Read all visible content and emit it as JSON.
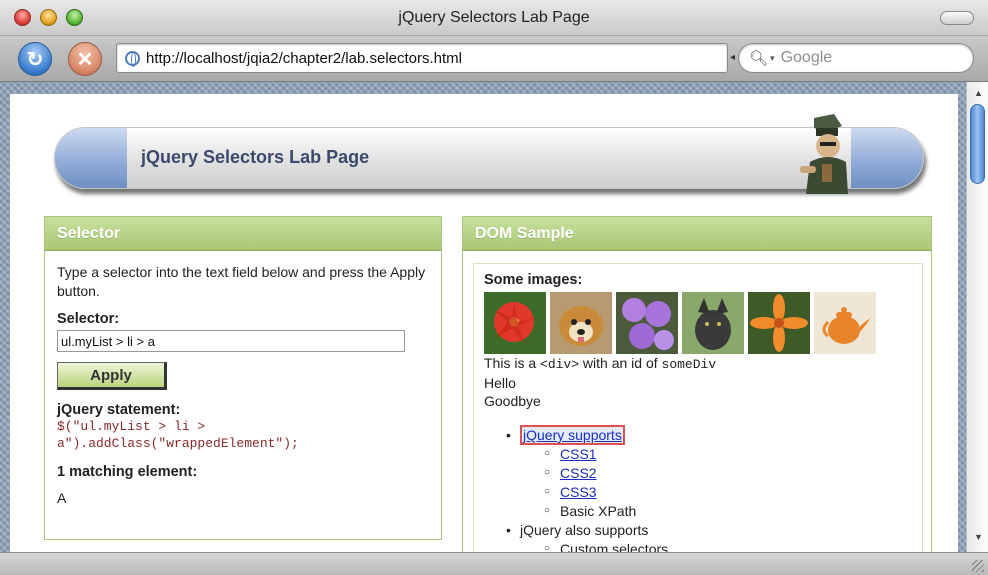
{
  "window": {
    "title": "jQuery Selectors Lab Page"
  },
  "toolbar": {
    "url": "http://localhost/jqia2/chapter2/lab.selectors.html",
    "search_placeholder": "Google"
  },
  "banner": {
    "title": "jQuery Selectors Lab Page"
  },
  "selector_panel": {
    "heading": "Selector",
    "intro": "Type a selector into the text field below and press the Apply button.",
    "selector_label": "Selector:",
    "selector_value": "ul.myList > li > a",
    "apply_label": "Apply",
    "statement_label": "jQuery statement:",
    "statement_code": "$(\"ul.myList > li >\na\").addClass(\"wrappedElement\");",
    "match_count_label": "1 matching element:",
    "match_result": "A"
  },
  "dom_panel": {
    "heading": "DOM Sample",
    "images_label": "Some images:",
    "div_text_prefix": "This is a ",
    "div_tag": "<div>",
    "div_text_mid": " with an id of ",
    "div_id": "someDiv",
    "hello": "Hello",
    "goodbye": "Goodbye",
    "list": {
      "item1_link": "jQuery supports",
      "sub1": [
        "CSS1",
        "CSS2",
        "CSS3"
      ],
      "sub1_text": "Basic XPath",
      "item2_text": "jQuery also supports",
      "sub2_text": "Custom selectors"
    }
  }
}
